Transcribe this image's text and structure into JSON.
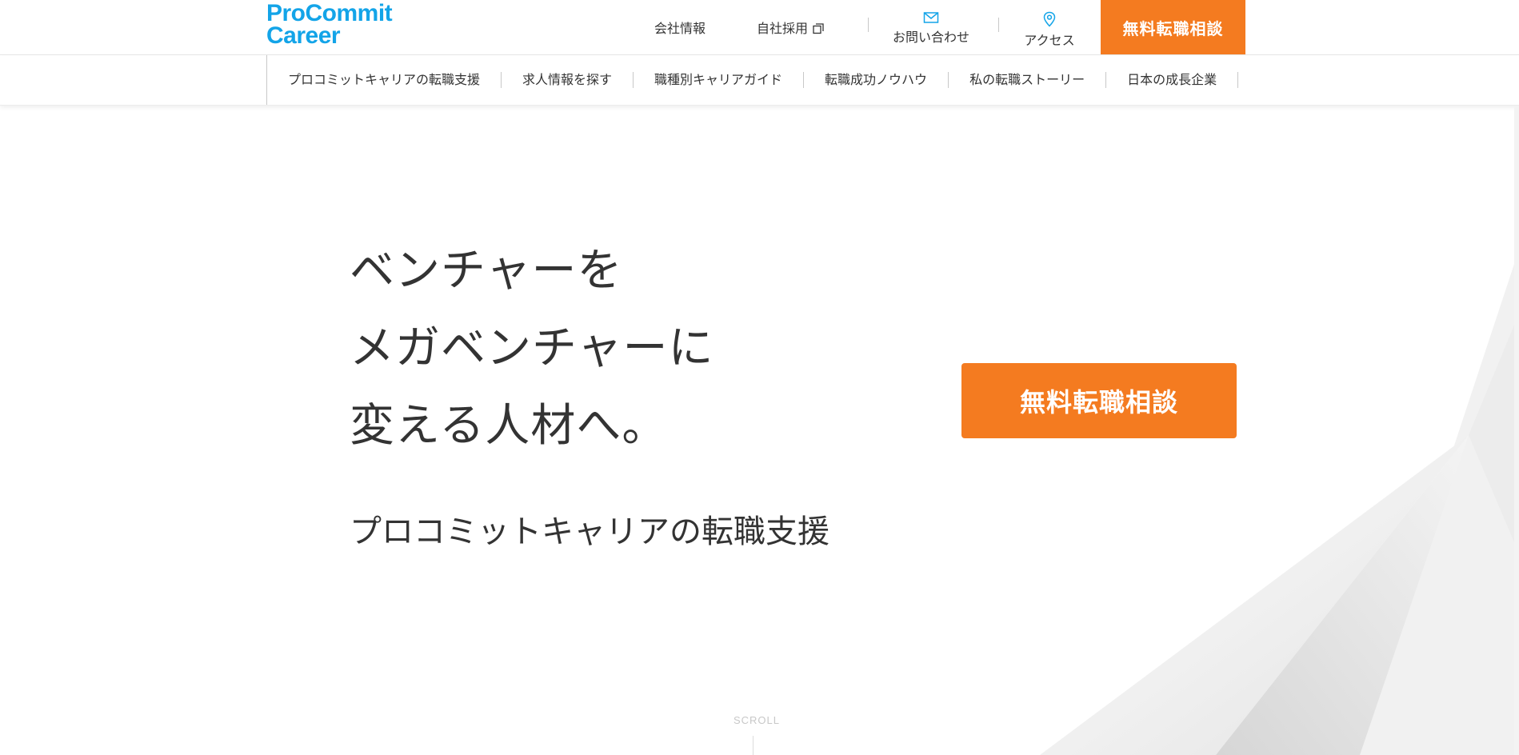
{
  "header": {
    "logo_line1": "ProCommit",
    "logo_line2": "Career",
    "links": {
      "company_info": "会社情報",
      "recruit": "自社採用",
      "contact": "お問い合わせ",
      "access": "アクセス"
    },
    "cta": "無料転職相談"
  },
  "nav": {
    "items": [
      "プロコミットキャリアの転職支援",
      "求人情報を探す",
      "職種別キャリアガイド",
      "転職成功ノウハウ",
      "私の転職ストーリー",
      "日本の成長企業"
    ]
  },
  "hero": {
    "title_lines": [
      "ベンチャーを",
      "メガベンチャーに",
      "変える人材へ。"
    ],
    "subtitle": "プロコミットキャリアの転職支援",
    "cta": "無料転職相談",
    "scroll": "SCROLL"
  },
  "colors": {
    "brand_blue": "#13a4e8",
    "accent_orange": "#f47b20",
    "text": "#333333"
  },
  "icons": {
    "recruit": "external-window-icon",
    "contact": "envelope-icon",
    "access": "map-pin-icon"
  }
}
